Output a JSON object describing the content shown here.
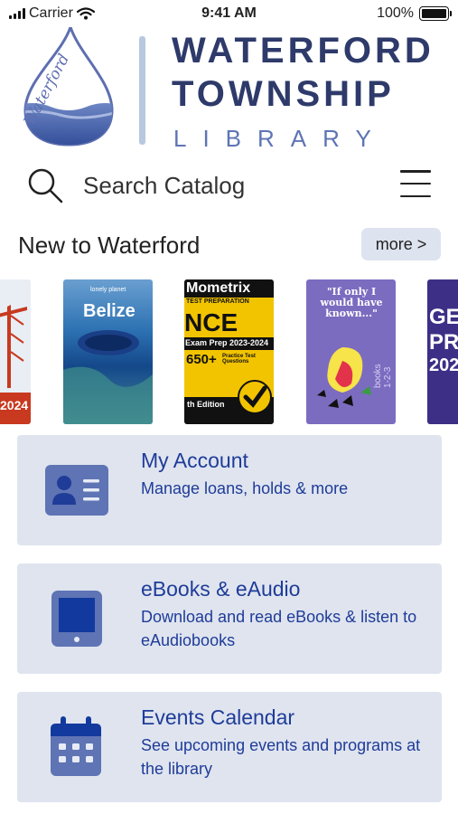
{
  "status_bar": {
    "carrier": "Carrier",
    "time": "9:41 AM",
    "battery": "100%"
  },
  "logo": {
    "line1": "WATERFORD",
    "line2": "TOWNSHIP",
    "line3": "LIBRARY",
    "script_text": "Waterford"
  },
  "search": {
    "label": "Search Catalog"
  },
  "new_section": {
    "title": "New to Waterford",
    "more_label": "more >"
  },
  "books": [
    {
      "cover_text": "2024",
      "colors": [
        "#c8391f",
        "#e8eef5"
      ]
    },
    {
      "cover_text": "Belize",
      "publisher": "lonely planet",
      "colors": [
        "#2d72b3"
      ]
    },
    {
      "cover_text_lines": [
        "Mometrix",
        "TEST PREPARATION",
        "NCE",
        "Exam Prep 2023-2024",
        "650+",
        "Practice Test Questions",
        "th Edition"
      ],
      "colors": [
        "#f2c400",
        "#111111"
      ]
    },
    {
      "cover_text_lines": [
        "\"If only I would have known...\"",
        "books 1-2-3"
      ],
      "colors": [
        "#7c6cc0"
      ]
    },
    {
      "cover_text_lines": [
        "GED",
        "PRE",
        "202"
      ],
      "colors": [
        "#3d2f86"
      ]
    }
  ],
  "cards": [
    {
      "title": "My Account",
      "desc": "Manage loans, holds & more",
      "icon": "id-card-icon"
    },
    {
      "title": "eBooks & eAudio",
      "desc": "Download and read eBooks & listen to eAudiobooks",
      "icon": "tablet-icon"
    },
    {
      "title": "Events Calendar",
      "desc": "See upcoming events and programs at the library",
      "icon": "calendar-icon"
    }
  ],
  "colors": {
    "accent": "#1f3c98",
    "card_bg": "#dfe4ef",
    "icon_fill": "#5e74b4",
    "logo_text": "#2e3a6a"
  }
}
